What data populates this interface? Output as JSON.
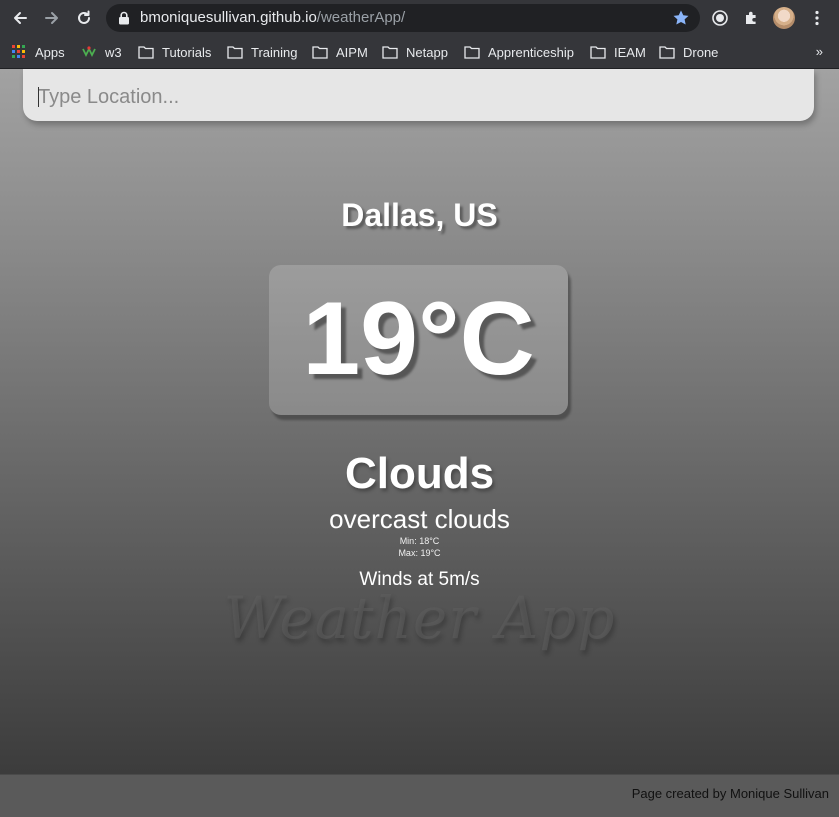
{
  "browser": {
    "url_host": "bmoniquesullivan.github.io",
    "url_path": "/weatherApp/",
    "bookmarks": [
      {
        "label": "Apps",
        "icon": "apps-grid-icon"
      },
      {
        "label": "w3",
        "icon": "w3-favicon-icon"
      },
      {
        "label": "Tutorials",
        "icon": "folder-icon"
      },
      {
        "label": "Training",
        "icon": "folder-icon"
      },
      {
        "label": "AIPM",
        "icon": "folder-icon"
      },
      {
        "label": "Netapp",
        "icon": "folder-icon"
      },
      {
        "label": "Apprenticeship",
        "icon": "folder-icon"
      },
      {
        "label": "IEAM",
        "icon": "folder-icon"
      },
      {
        "label": "Drone",
        "icon": "folder-icon"
      }
    ],
    "more_bookmarks": "»"
  },
  "search": {
    "placeholder": "Type Location..."
  },
  "weather": {
    "location": "Dallas, US",
    "temperature": "19°C",
    "main": "Clouds",
    "description": "overcast clouds",
    "min": "Min: 18°C",
    "max": "Max: 19°C",
    "wind": "Winds at 5m/s"
  },
  "watermark": "Weather App",
  "footer": {
    "credit": "Page created by Monique Sullivan"
  },
  "colors": {
    "star": "#8ab4f8",
    "chrome_bg": "#35363a",
    "omnibox_bg": "#202124",
    "search_bg": "#e6e6e6",
    "footer_bg": "#5a5a5a"
  }
}
